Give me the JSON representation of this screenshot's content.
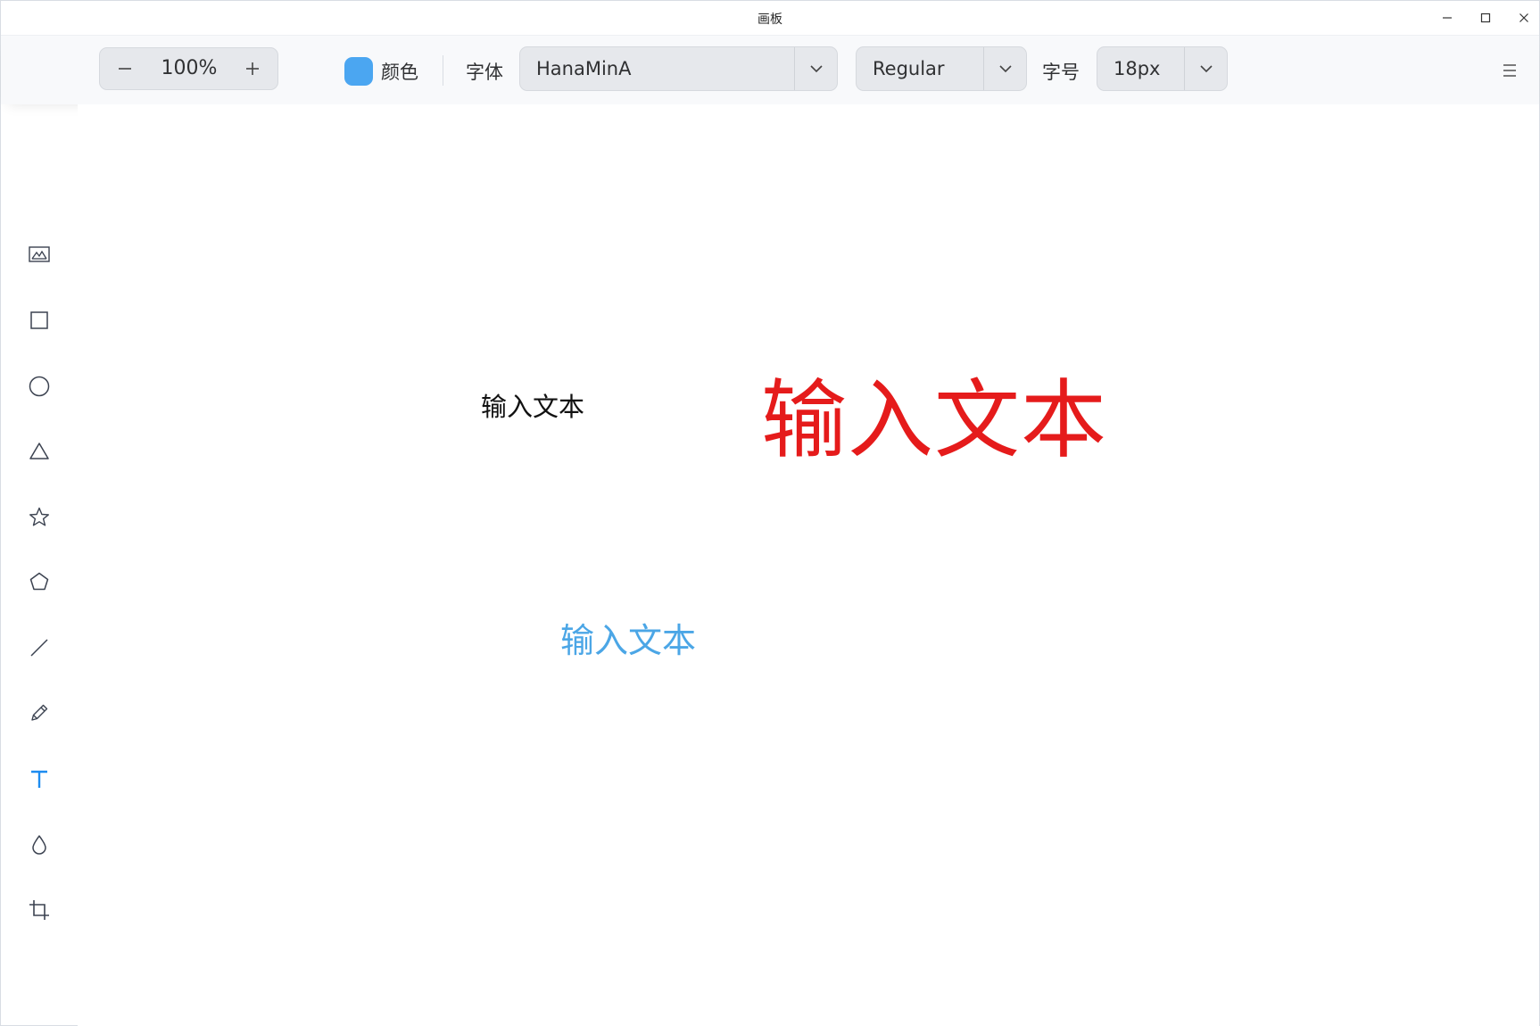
{
  "window": {
    "title": "画板"
  },
  "toolbar": {
    "zoom": {
      "value": "100%",
      "decrease_icon": "minus-icon",
      "increase_icon": "plus-icon"
    },
    "color": {
      "label": "颜色",
      "swatch": "#4ba6f1"
    },
    "font": {
      "label": "字体",
      "family": "HanaMinA",
      "weight": "Regular"
    },
    "size": {
      "label": "字号",
      "value": "18px"
    },
    "menu_icon": "hamburger-menu-icon"
  },
  "sidebar": {
    "tools": [
      {
        "id": "image",
        "icon": "image-icon",
        "active": false
      },
      {
        "id": "rectangle",
        "icon": "rectangle-icon",
        "active": false
      },
      {
        "id": "ellipse",
        "icon": "ellipse-icon",
        "active": false
      },
      {
        "id": "triangle",
        "icon": "triangle-icon",
        "active": false
      },
      {
        "id": "star",
        "icon": "star-icon",
        "active": false
      },
      {
        "id": "polygon",
        "icon": "pentagon-icon",
        "active": false
      },
      {
        "id": "line",
        "icon": "line-icon",
        "active": false
      },
      {
        "id": "pencil",
        "icon": "pencil-icon",
        "active": false
      },
      {
        "id": "text",
        "icon": "text-icon",
        "active": true
      },
      {
        "id": "blur",
        "icon": "blur-drop-icon",
        "active": false
      },
      {
        "id": "crop",
        "icon": "crop-icon",
        "active": false
      }
    ],
    "accent_color": "#1d8cf0"
  },
  "canvas": {
    "texts": [
      {
        "text": "输入文本",
        "color": "#111111"
      },
      {
        "text": "输入文本",
        "color": "#e51b1b"
      },
      {
        "text": "输入文本",
        "color": "#4ba6e6"
      }
    ]
  }
}
